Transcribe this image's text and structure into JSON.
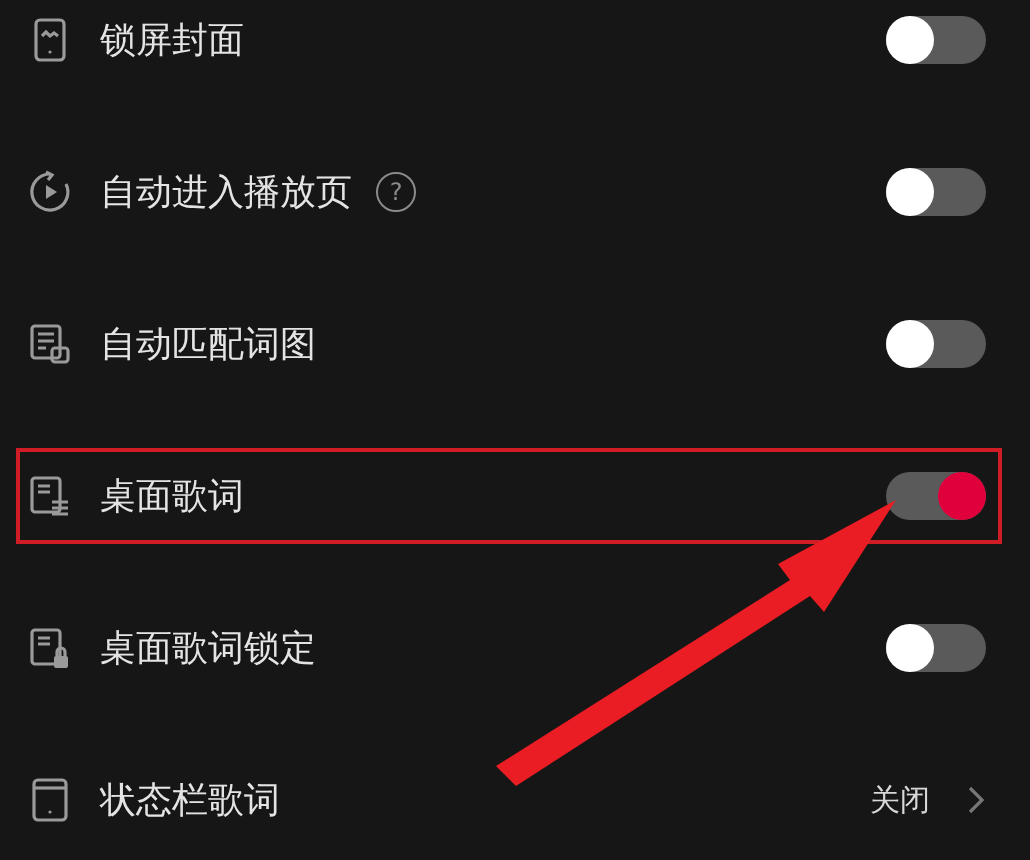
{
  "settings": [
    {
      "kind": "toggle",
      "label": "锁屏封面",
      "on": false,
      "highlighted": false
    },
    {
      "kind": "toggle",
      "label": "自动进入播放页",
      "help": "?",
      "on": false,
      "highlighted": false
    },
    {
      "kind": "toggle",
      "label": "自动匹配词图",
      "on": false,
      "highlighted": false
    },
    {
      "kind": "toggle",
      "label": "桌面歌词",
      "on": true,
      "highlighted": true
    },
    {
      "kind": "toggle",
      "label": "桌面歌词锁定",
      "on": false,
      "highlighted": false
    },
    {
      "kind": "link",
      "label": "状态栏歌词",
      "value": "关闭",
      "highlighted": false
    }
  ],
  "annotation": {
    "kind": "arrow"
  }
}
